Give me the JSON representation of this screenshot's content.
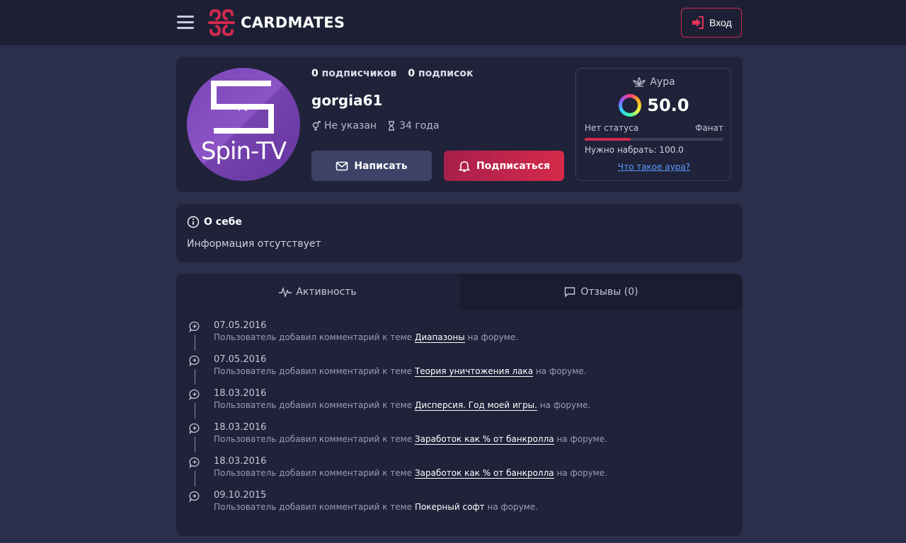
{
  "header": {
    "logo_text": "CARDMATES",
    "login_label": "Вход",
    "accent": "#d12a4f"
  },
  "profile": {
    "avatar_text": "Spin-TV",
    "avatar_badge": "TV",
    "followers_count": "0",
    "followers_label": "подписчиков",
    "following_count": "0",
    "following_label": "подписок",
    "username": "gorgia61",
    "gender": "Не указан",
    "age": "34 года",
    "write_label": "Написать",
    "subscribe_label": "Подписаться"
  },
  "aura": {
    "title": "Аура",
    "value": "50.0",
    "status_left": "Нет статуса",
    "status_right": "Фанат",
    "progress": 0.33,
    "need_text": "Нужно набрать: 100.0",
    "link": "Что такое аура?"
  },
  "about": {
    "title": "О себе",
    "text": "Информация отсутствует"
  },
  "tabs": [
    {
      "label": "Активность",
      "icon": "activity-icon"
    },
    {
      "label": "Отзывы (0)",
      "icon": "comment-icon"
    }
  ],
  "feed": {
    "prefix": "Пользователь добавил комментарий к теме",
    "suffix": "на форуме.",
    "items": [
      {
        "date": "07.05.2016",
        "topic": "Диапазоны"
      },
      {
        "date": "07.05.2016",
        "topic": "Теория уничтожения лака"
      },
      {
        "date": "18.03.2016",
        "topic": "Дисперсия. Год моей игры."
      },
      {
        "date": "18.03.2016",
        "topic": "Заработок как % от банкролла"
      },
      {
        "date": "18.03.2016",
        "topic": "Заработок как % от банкролла"
      },
      {
        "date": "09.10.2015",
        "topic": "Покерный софт"
      }
    ]
  }
}
